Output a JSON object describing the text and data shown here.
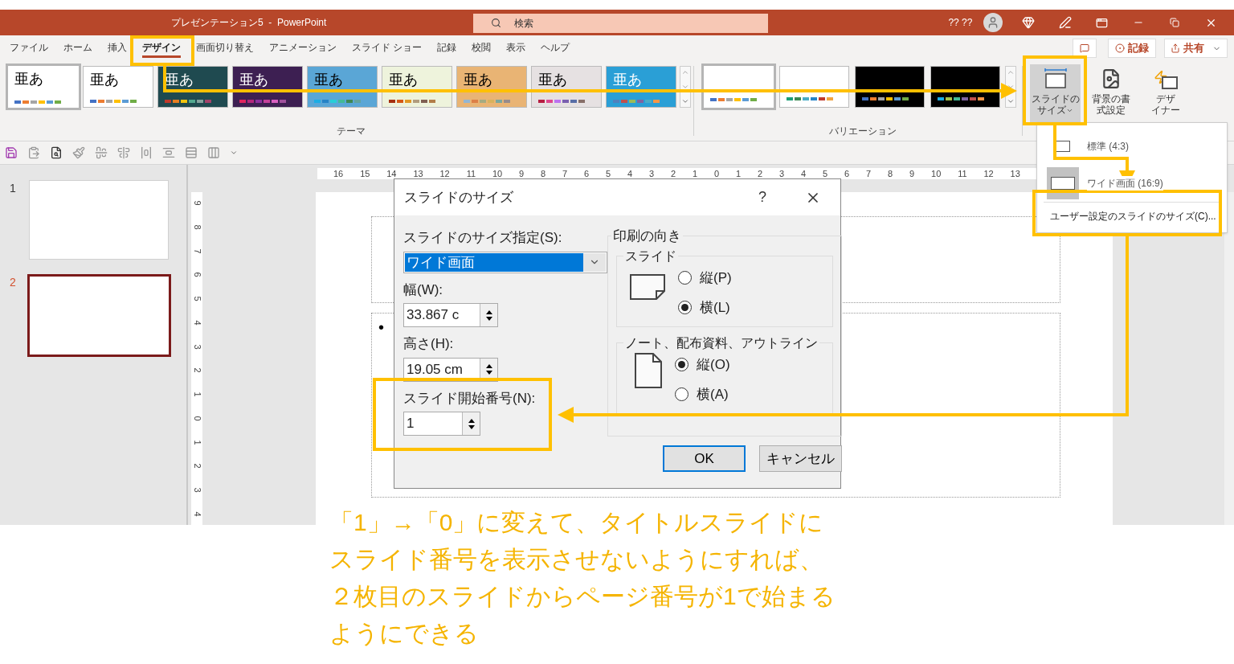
{
  "title_bar": {
    "title": "プレゼンテーション5  -  PowerPoint",
    "search": {
      "placeholder": "検索"
    },
    "user": "?? ??"
  },
  "tabs": [
    {
      "label": "ファイル",
      "selected": false
    },
    {
      "label": "ホーム",
      "selected": false
    },
    {
      "label": "挿入",
      "selected": false
    },
    {
      "label": "デザイン",
      "selected": true
    },
    {
      "label": "画面切り替え",
      "selected": false
    },
    {
      "label": "アニメーション",
      "selected": false
    },
    {
      "label": "スライド ショー",
      "selected": false
    },
    {
      "label": "記録",
      "selected": false
    },
    {
      "label": "校閲",
      "selected": false
    },
    {
      "label": "表示",
      "selected": false
    },
    {
      "label": "ヘルプ",
      "selected": false
    }
  ],
  "header_actions": {
    "record": "記録",
    "share": "共有"
  },
  "themes": {
    "group_label": "テーマ",
    "items": [
      {
        "label": "亜あ",
        "selected": true
      },
      {
        "label": "亜あ",
        "selected": false
      },
      {
        "label": "亜あ",
        "selected": false
      },
      {
        "label": "亜あ",
        "selected": false
      },
      {
        "label": "亜あ",
        "selected": false
      },
      {
        "label": "亜あ",
        "selected": false
      },
      {
        "label": "亜あ",
        "selected": false
      },
      {
        "label": "亜あ",
        "selected": false
      },
      {
        "label": "亜あ",
        "selected": false
      }
    ]
  },
  "variations": {
    "group_label": "バリエーション",
    "items": [
      {
        "selected": true
      },
      {
        "selected": false
      },
      {
        "selected": false
      },
      {
        "selected": false
      }
    ]
  },
  "ribbon_buttons": [
    {
      "kind": "slide_size",
      "lines": [
        "スライドの",
        "サイズ"
      ]
    },
    {
      "kind": "background",
      "lines": [
        "背景の書",
        "式設定"
      ]
    },
    {
      "kind": "designer",
      "lines": [
        "デザ",
        "イナー"
      ]
    }
  ],
  "slide_size_menu": {
    "options": [
      {
        "label": "標準 (4:3)",
        "selected": false
      },
      {
        "label": "ワイド画面 (16:9)",
        "selected": true
      }
    ],
    "custom": "ユーザー設定のスライドのサイズ(C)..."
  },
  "rulers": {
    "horizontal": [
      "16",
      "15",
      "14",
      "13",
      "12",
      "11",
      "10",
      "9",
      "8",
      "7",
      "6",
      "5",
      "4",
      "3",
      "2",
      "1",
      "0",
      "1",
      "2",
      "3",
      "4",
      "5",
      "6",
      "7",
      "8",
      "9",
      "10",
      "11",
      "12",
      "13"
    ],
    "vertical": [
      "9",
      "8",
      "7",
      "6",
      "5",
      "4",
      "3",
      "2",
      "1",
      "0",
      "1",
      "2",
      "3",
      "4"
    ]
  },
  "slides": [
    {
      "number": "1",
      "selected": false
    },
    {
      "number": "2",
      "selected": true
    }
  ],
  "slide_content": {
    "bullet": "•"
  },
  "dialog": {
    "title": "スライドのサイズ",
    "help": "?",
    "size_label": "スライドのサイズ指定(S):",
    "size_value": "ワイド画面",
    "width_label": "幅(W):",
    "width_value": "33.867 c",
    "height_label": "高さ(H):",
    "height_value": "19.05 cm",
    "start_label": "スライド開始番号(N):",
    "start_value": "1",
    "orientation_label": "印刷の向き",
    "orientation_groups": [
      {
        "label": "スライド",
        "options": [
          {
            "label": "縦(P)",
            "selected": false
          },
          {
            "label": "横(L)",
            "selected": true
          }
        ]
      },
      {
        "label": "ノート、配布資料、アウトライン",
        "options": [
          {
            "label": "縦(O)",
            "selected": true
          },
          {
            "label": "横(A)",
            "selected": false
          }
        ]
      }
    ],
    "ok": "OK",
    "cancel": "キャンセル"
  },
  "annotation": {
    "lines": [
      "「1」→「0」に変えて、タイトルスライドに",
      "スライド番号を表示させないようにすれば、",
      "２枚目のスライドからページ番号が1で始まる",
      "ようにできる"
    ]
  }
}
